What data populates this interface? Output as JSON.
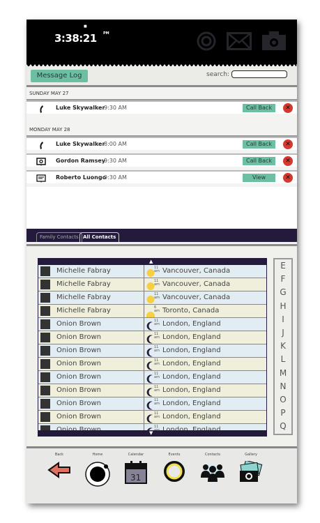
{
  "header": {
    "time": "3:38:21",
    "ampm": "PM",
    "icons": [
      "target-icon",
      "mail-icon",
      "camera-icon"
    ]
  },
  "toolbar": {
    "message_log": "Message Log",
    "search_label": "search:",
    "search_value": ""
  },
  "messages": {
    "groups": [
      {
        "date": "SUNDAY MAY 27",
        "items": [
          {
            "icon": "phone-icon",
            "name": "Luke Skywalker",
            "time": "9:30 AM",
            "action": "Call Back"
          }
        ]
      },
      {
        "date": "MONDAY MAY 28",
        "items": [
          {
            "icon": "phone-icon",
            "name": "Luke Skywalker",
            "time": "8:00 AM",
            "action": "Call Back"
          },
          {
            "icon": "video-message-icon",
            "name": "Gordon Ramsey",
            "time": "9:30 AM",
            "action": "Call Back"
          },
          {
            "icon": "text-message-icon",
            "name": "Roberto Luongo",
            "time": "9:30 AM",
            "action": "View"
          }
        ]
      }
    ],
    "delete_glyph": "✕"
  },
  "tabs": [
    {
      "label": "Family Contacts",
      "active": false
    },
    {
      "label": "All Contacts",
      "active": true
    }
  ],
  "contacts": [
    {
      "name": "Michelle Fabray",
      "weather": "sun",
      "time": "11",
      "ap": "am",
      "location": "Vancouver, Canada"
    },
    {
      "name": "Michelle Fabray",
      "weather": "sun",
      "time": "11",
      "ap": "am",
      "location": "Vancouver, Canada"
    },
    {
      "name": "Michelle Fabray",
      "weather": "sun",
      "time": "11",
      "ap": "am",
      "location": "Vancouver, Canada"
    },
    {
      "name": "Michelle Fabray",
      "weather": "sunrise",
      "time": "6",
      "ap": "am",
      "location": "Toronto, Canada"
    },
    {
      "name": "Onion Brown",
      "weather": "moon",
      "time": "11",
      "ap": "am",
      "location": "London, England"
    },
    {
      "name": "Onion Brown",
      "weather": "moon",
      "time": "11",
      "ap": "am",
      "location": "London, England"
    },
    {
      "name": "Onion Brown",
      "weather": "moon",
      "time": "11",
      "ap": "am",
      "location": "London, England"
    },
    {
      "name": "Onion Brown",
      "weather": "moon",
      "time": "11",
      "ap": "am",
      "location": "London, England"
    },
    {
      "name": "Onion Brown",
      "weather": "moon",
      "time": "11",
      "ap": "am",
      "location": "London, England"
    },
    {
      "name": "Onion Brown",
      "weather": "moon",
      "time": "11",
      "ap": "am",
      "location": "London, England"
    },
    {
      "name": "Onion Brown",
      "weather": "moon",
      "time": "11",
      "ap": "am",
      "location": "London, England"
    },
    {
      "name": "Onion Brown",
      "weather": "moon",
      "time": "11",
      "ap": "am",
      "location": "London, England"
    },
    {
      "name": "Onion Brown",
      "weather": "moon",
      "time": "11",
      "ap": "am",
      "location": "London, England"
    }
  ],
  "alphabet": [
    "E",
    "F",
    "G",
    "H",
    "I",
    "J",
    "K",
    "L",
    "M",
    "N",
    "O",
    "P",
    "Q"
  ],
  "nav": [
    {
      "label": "Back",
      "icon": "back-arrow-icon"
    },
    {
      "label": "Home",
      "icon": "home-icon"
    },
    {
      "label": "Calendar",
      "icon": "calendar-icon",
      "day": "31"
    },
    {
      "label": "Events",
      "icon": "events-icon"
    },
    {
      "label": "Contacts",
      "icon": "contacts-icon"
    },
    {
      "label": "Gallery",
      "icon": "gallery-icon"
    }
  ],
  "colors": {
    "accent": "#6cbfa3",
    "delete": "#d5382f",
    "tabbar": "#241a3c",
    "row_blue": "#e2edf3",
    "row_beige": "#efefdc"
  }
}
